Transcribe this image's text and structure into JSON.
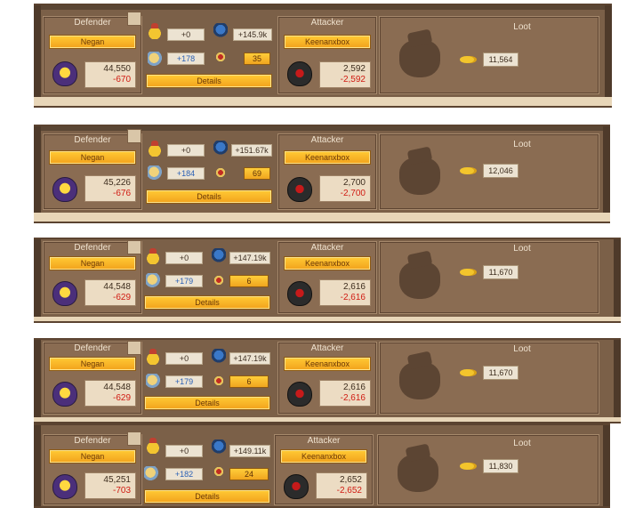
{
  "labels": {
    "defender": "Defender",
    "attacker": "Attacker",
    "loot": "Loot",
    "details": "Details"
  },
  "rows": [
    {
      "defender_name": "Negan",
      "defender_trophies": "44,550",
      "defender_delta": "-670",
      "orb_value": "+0",
      "crest_value": "+145.9k",
      "blue_value": "+178",
      "caduceus_value": "35",
      "attacker_name": "Keenanxbox",
      "attacker_trophies": "2,592",
      "attacker_delta": "-2,592",
      "loot_value": "11,564"
    },
    {
      "defender_name": "Negan",
      "defender_trophies": "45,226",
      "defender_delta": "-676",
      "orb_value": "+0",
      "crest_value": "+151.67k",
      "blue_value": "+184",
      "caduceus_value": "69",
      "attacker_name": "Keenanxbox",
      "attacker_trophies": "2,700",
      "attacker_delta": "-2,700",
      "loot_value": "12,046"
    },
    {
      "defender_name": "Negan",
      "defender_trophies": "44,548",
      "defender_delta": "-629",
      "orb_value": "+0",
      "crest_value": "+147.19k",
      "blue_value": "+179",
      "caduceus_value": "6",
      "attacker_name": "Keenanxbox",
      "attacker_trophies": "2,616",
      "attacker_delta": "-2,616",
      "loot_value": "11,670"
    },
    {
      "defender_name": "Negan",
      "defender_trophies": "44,548",
      "defender_delta": "-629",
      "orb_value": "+0",
      "crest_value": "+147.19k",
      "blue_value": "+179",
      "caduceus_value": "6",
      "attacker_name": "Keenanxbox",
      "attacker_trophies": "2,616",
      "attacker_delta": "-2,616",
      "loot_value": "11,670"
    },
    {
      "defender_name": "Negan",
      "defender_trophies": "45,251",
      "defender_delta": "-703",
      "orb_value": "+0",
      "crest_value": "+149.11k",
      "blue_value": "+182",
      "caduceus_value": "24",
      "attacker_name": "Keenanxbox",
      "attacker_trophies": "2,652",
      "attacker_delta": "-2,652",
      "loot_value": "11,830"
    }
  ],
  "icons": {
    "orb": "orb-icon",
    "crest": "crest-icon",
    "blue": "knight-icon",
    "caduceus": "caduceus-icon",
    "loot_bag": "loot-bag-icon",
    "coin": "coin-icon",
    "defender_shield": "defender-shield-icon",
    "attacker_shield": "attacker-shield-icon",
    "scroll": "scroll-icon"
  }
}
